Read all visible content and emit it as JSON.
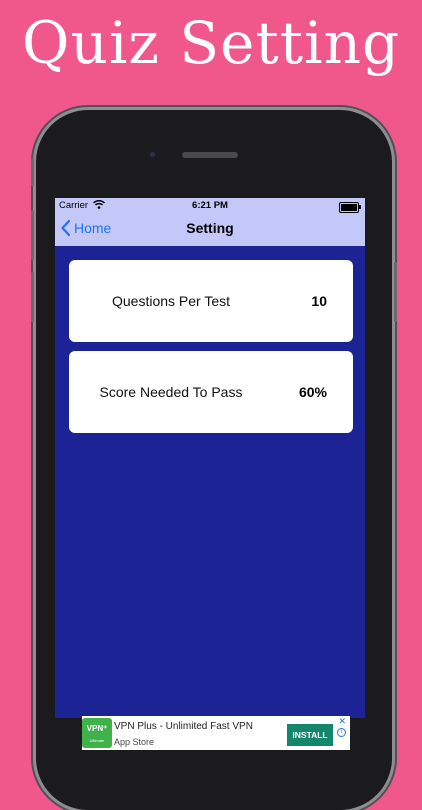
{
  "promo": {
    "title": "Quiz Setting"
  },
  "status_bar": {
    "carrier": "Carrier",
    "time": "6:21 PM"
  },
  "nav": {
    "back_label": "Home",
    "title": "Setting"
  },
  "settings": [
    {
      "label": "Questions Per Test",
      "value": "10"
    },
    {
      "label": "Score Needed To Pass",
      "value": "60%"
    }
  ],
  "ad": {
    "title": "VPN Plus - Unlimited Fast VPN",
    "subtitle": "App Store",
    "install_label": "INSTALL",
    "icon_text": "VPN⁺",
    "icon_subtext": "Ultimate",
    "close_glyph": "✕",
    "info_glyph": "i"
  },
  "colors": {
    "background": "#f0578a",
    "nav_bar": "#c4c8f8",
    "screen_bg": "#1b2395",
    "accent": "#1e74f3",
    "install_button": "#12876b"
  }
}
